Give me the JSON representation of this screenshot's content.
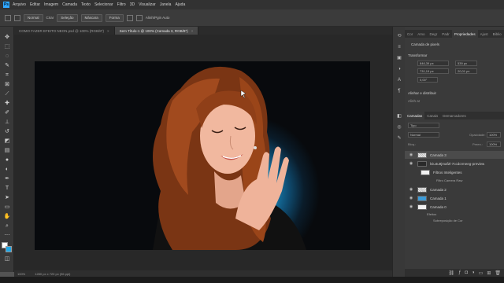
{
  "menubar": {
    "items": [
      "Arquivo",
      "Editar",
      "Imagem",
      "Camada",
      "Texto",
      "Selecionar",
      "Filtro",
      "3D",
      "Visualizar",
      "Janela",
      "Ajuda"
    ]
  },
  "options": {
    "preset": "Normal",
    "sample": "Criar",
    "select": "Seleção",
    "mask": "Máscara",
    "shape": "Forma",
    "auto": "Alinh/Pgin Auto"
  },
  "tabs": [
    {
      "label": "COMO FAZER EFEITO NEON.psd @ 100% (RGB/8*)",
      "active": false
    },
    {
      "label": "Sem Título-1 @ 100% (Camada 3, RGB/8*)",
      "active": true
    }
  ],
  "status": {
    "zoom": "100%",
    "doc": "1280 px x 720 px (96 ppi)"
  },
  "panels": {
    "top_tabs": [
      "Cor",
      "Amo",
      "Degr",
      "Padr",
      "Propriedades",
      "Ajust",
      "Biblio"
    ],
    "active_top_tab": "Propriedades",
    "layer_kind": "Camada de pixels",
    "transform_title": "Transformar",
    "w_value": "846,39 px",
    "h_value": "731,19 px",
    "x_value": "539 px",
    "y_value": "20,01 px",
    "angle": "0,00°",
    "align_title": "Alinhar e distribuir",
    "align_sub": "Alinh ar",
    "layers_tabs": [
      "Camadas",
      "Canais",
      "Demarcadores"
    ],
    "layers_search": "Tipo",
    "blend": "Normal",
    "opacity_label": "Opacidade:",
    "opacity": "100%",
    "lock_label": "Bloq.:",
    "fill_label": "Preen.:",
    "fill": "100%"
  },
  "layers": [
    {
      "name": "Camada 3",
      "thumb": "check",
      "sel": true
    },
    {
      "name": "lviu4u9jmaf2l-7ccdcrmeeg-preview",
      "thumb": "dark",
      "sel": false
    },
    {
      "name": "Filtros Inteligentes",
      "thumb": "white",
      "sel": false
    },
    {
      "name": "Filtro Camera Raw",
      "thumb": "none",
      "sel": false
    },
    {
      "name": "Camada 2",
      "thumb": "check",
      "sel": false
    },
    {
      "name": "Camada 1",
      "thumb": "blue",
      "sel": false
    },
    {
      "name": "Camada 0",
      "thumb": "white",
      "sel": false
    },
    {
      "name": "Efeitos",
      "thumb": "none",
      "sel": false
    },
    {
      "name": "Sobreposição de Cor",
      "thumb": "none",
      "sel": false
    }
  ],
  "colors": {
    "foreground": "#ffffff",
    "background": "#1fa7e6",
    "glow": "#2bb7ea"
  }
}
